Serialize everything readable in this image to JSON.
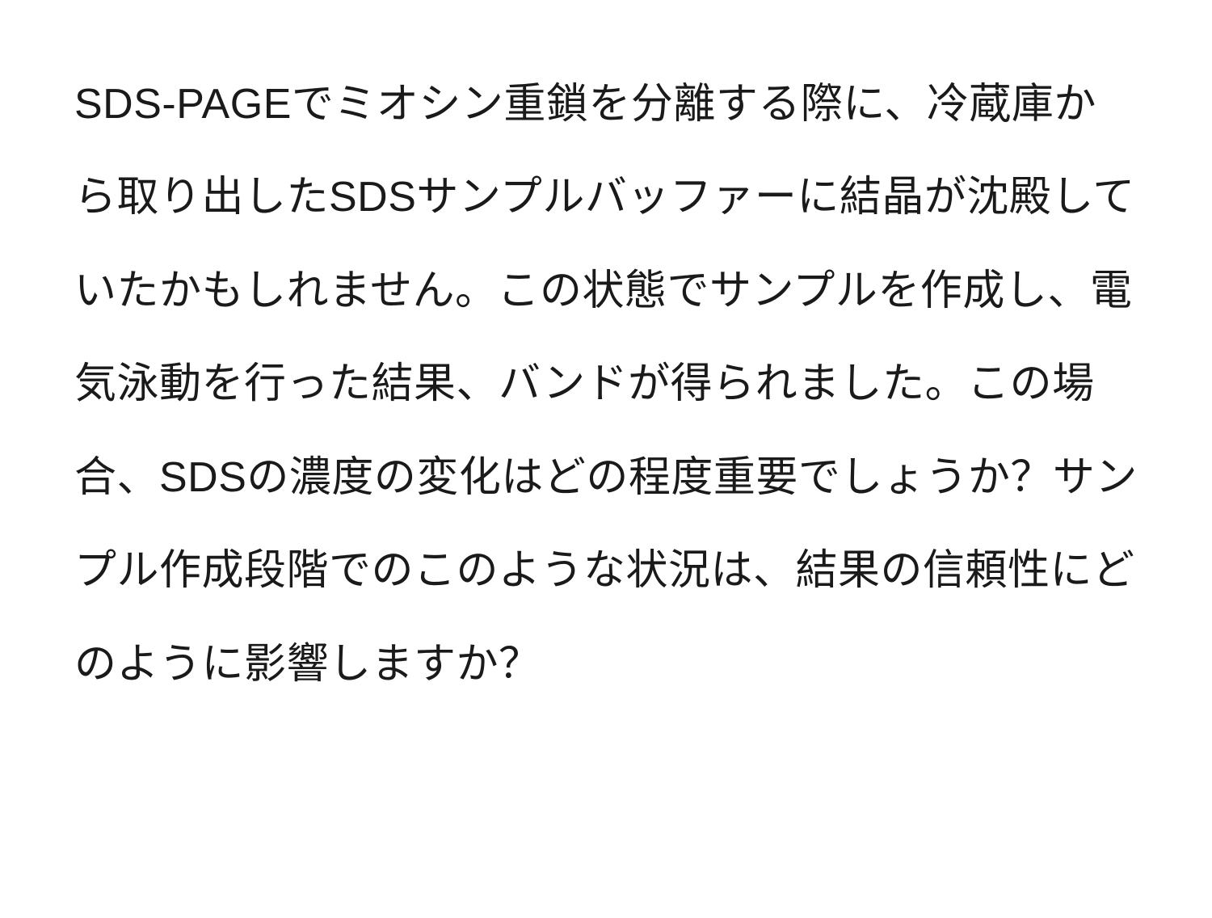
{
  "document": {
    "body_text": "SDS-PAGEでミオシン重鎖を分離する際に、冷蔵庫から取り出したSDSサンプルバッファーに結晶が沈殿していたかもしれません。この状態でサンプルを作成し、電気泳動を行った結果、バンドが得られました。この場合、SDSの濃度の変化はどの程度重要でしょうか？サンプル作成段階でのこのような状況は、結果の信頼性にどのように影響しますか？"
  }
}
